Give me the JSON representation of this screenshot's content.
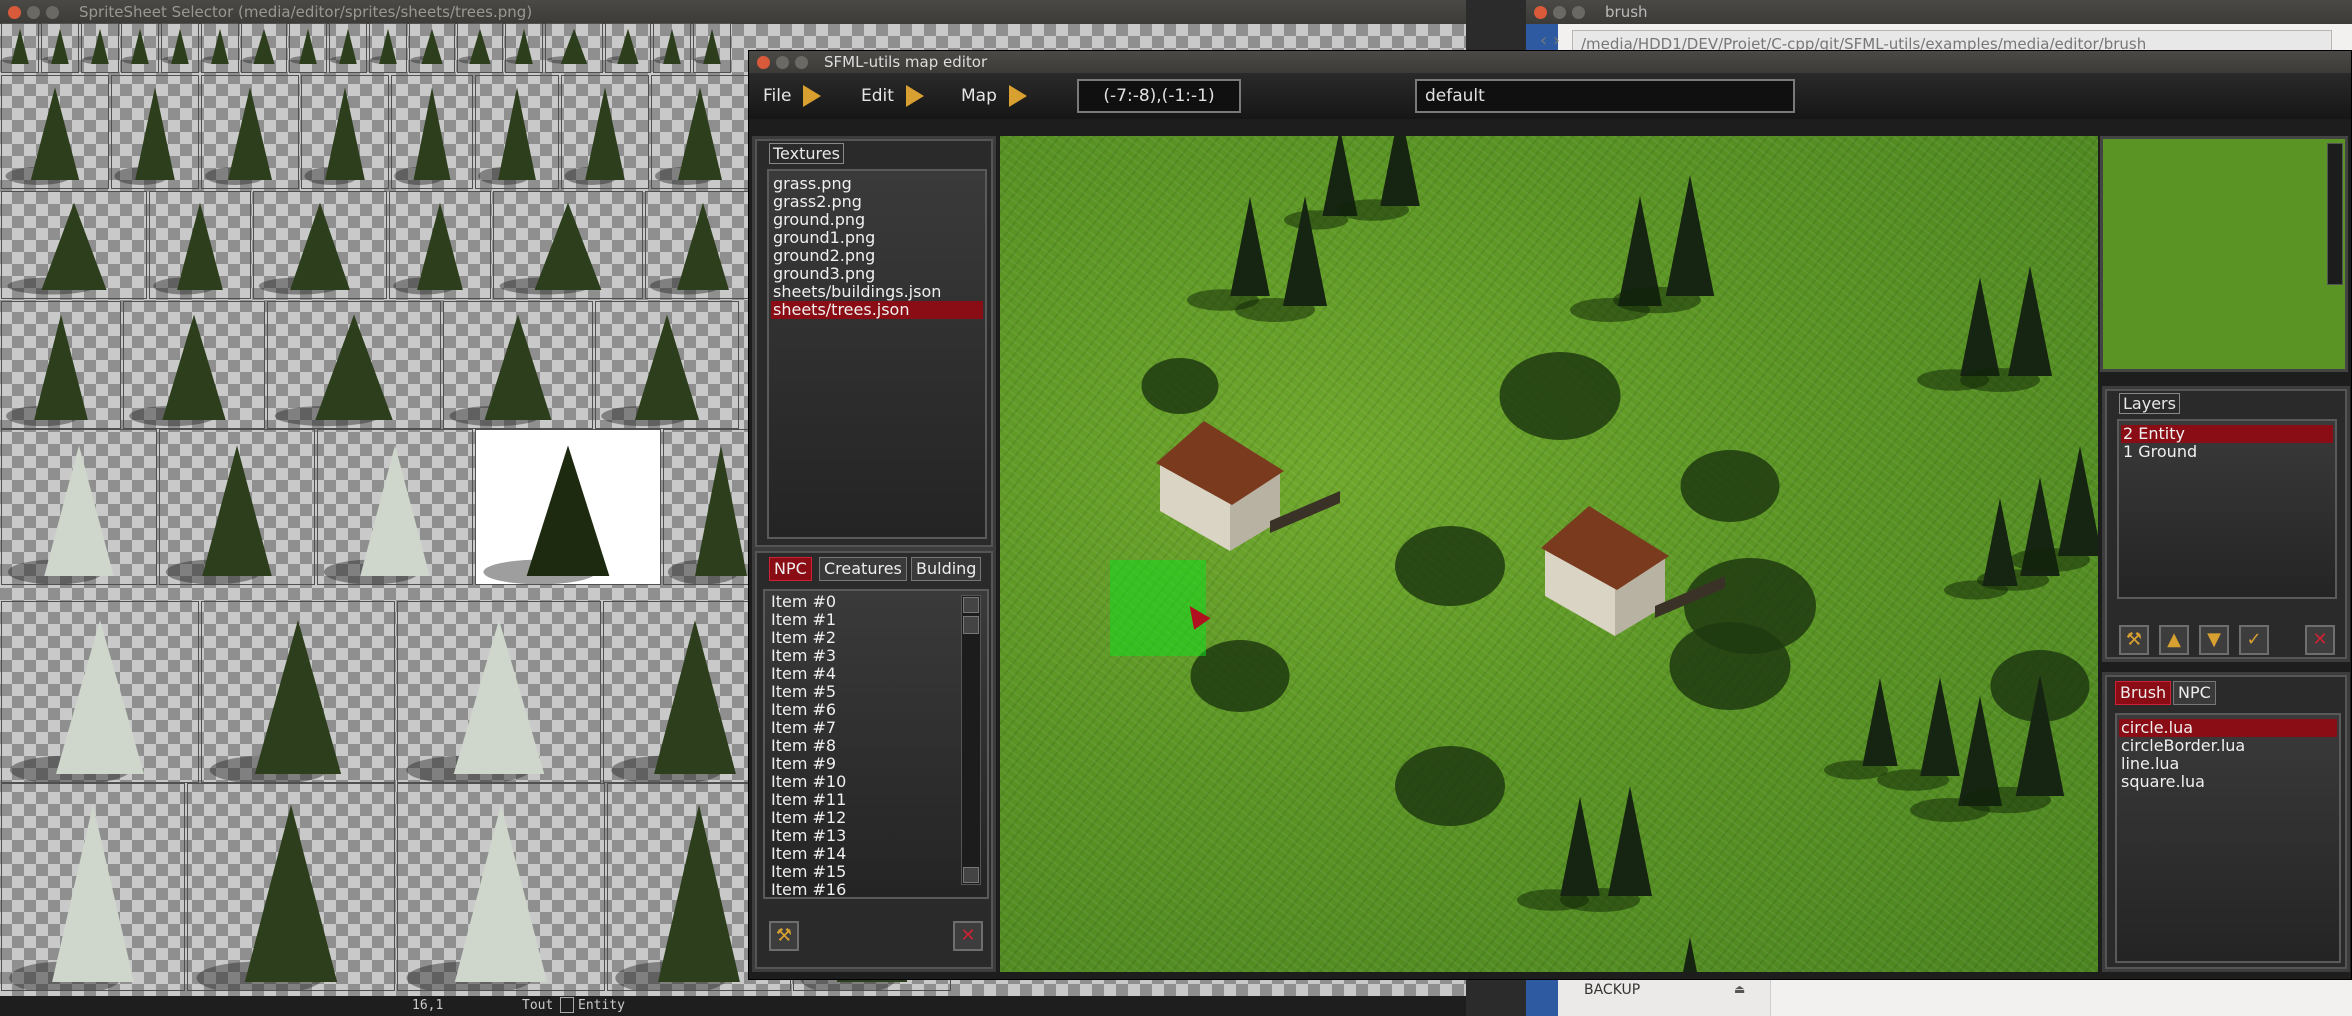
{
  "sprite_window": {
    "title": "SpriteSheet Selector (media/editor/sprites/sheets/trees.png)",
    "status_coords": "16,1",
    "status_filter": "Tout",
    "status_layer": "Entity"
  },
  "browser_window": {
    "title": "brush",
    "path": "/media/HDD1/DEV/Projet/C-cpp/git/SFML-utils/examples/media/editor/brush",
    "sidebar_item": "BACKUP"
  },
  "editor": {
    "title": "SFML-utils map editor",
    "menus": [
      "File",
      "Edit",
      "Map"
    ],
    "coords": "(-7:-8),(-1:-1)",
    "map_name": "default",
    "textures": {
      "legend": "Textures",
      "items": [
        "grass.png",
        "grass2.png",
        "ground.png",
        "ground1.png",
        "ground2.png",
        "ground3.png",
        "sheets/buildings.json",
        "sheets/trees.json"
      ],
      "selected": 7
    },
    "entity_tabs": [
      "NPC",
      "Creatures",
      "Bulding"
    ],
    "entity_items": [
      "Item #0",
      "Item #1",
      "Item #2",
      "Item #3",
      "Item #4",
      "Item #5",
      "Item #6",
      "Item #7",
      "Item #8",
      "Item #9",
      "Item #10",
      "Item #11",
      "Item #12",
      "Item #13",
      "Item #14",
      "Item #15",
      "Item #16"
    ],
    "layers": {
      "legend": "Layers",
      "items": [
        "2 Entity",
        "1 Ground"
      ],
      "selected": 0
    },
    "brush_tabs": [
      "Brush",
      "NPC"
    ],
    "brushes": {
      "items": [
        "circle.lua",
        "circleBorder.lua",
        "line.lua",
        "square.lua"
      ],
      "selected": 0
    },
    "icons": {
      "hammer": "hammer-icon",
      "close": "close-icon",
      "up": "move-up-icon",
      "down": "move-down-icon",
      "check": "check-icon"
    },
    "colors": {
      "selection": "#8a0c14",
      "arrow": "#d8a030",
      "brush_preview": "#14dc1e"
    }
  }
}
